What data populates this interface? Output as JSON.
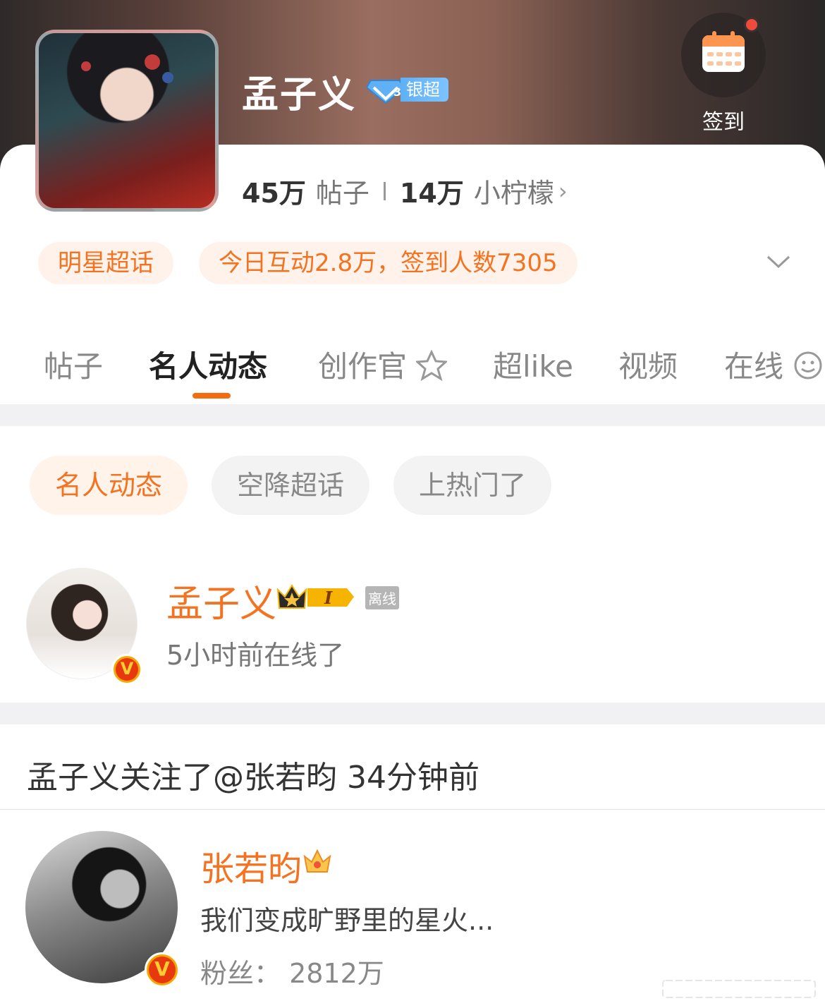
{
  "header": {
    "title": "孟子义",
    "badge_label": "银超",
    "checkin_label": "签到",
    "stats": {
      "posts_count": "45万",
      "posts_label": "帖子",
      "lemons_count": "14万",
      "lemons_label": "小柠檬",
      "chevron": "›"
    }
  },
  "tags": {
    "category": "明星超话",
    "activity": "今日互动2.8万，签到人数7305"
  },
  "tabs": [
    "帖子",
    "名人动态",
    "创作官",
    "超like",
    "视频",
    "在线"
  ],
  "subtabs": [
    "名人动态",
    "空降超话",
    "上热门了"
  ],
  "online_user": {
    "name": "孟子义",
    "level": "I",
    "status": "离线",
    "last_seen": "5小时前在线了",
    "verified_mark": "V"
  },
  "follow_event": {
    "text": "孟子义关注了@张若昀 34分钟前"
  },
  "followed_user": {
    "name": "张若昀",
    "bio": "我们变成旷野里的星火...",
    "fans": "粉丝： 2812万",
    "verified_mark": "V"
  },
  "colors": {
    "accent": "#f47321",
    "tab_indicator": "#f36d10",
    "silver_badge": "#5fb0f5"
  }
}
